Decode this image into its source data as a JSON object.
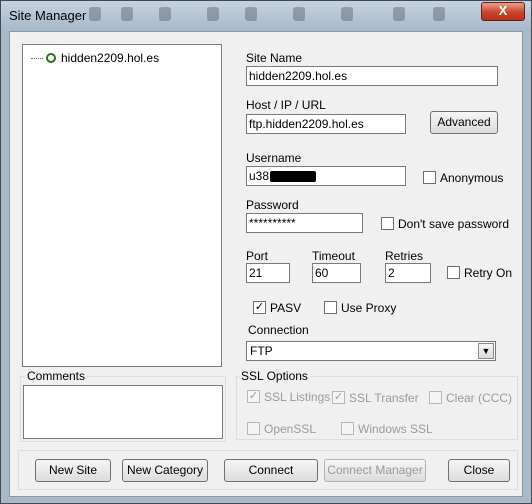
{
  "window": {
    "title": "Site Manager",
    "close_glyph": "X"
  },
  "tree": {
    "items": [
      {
        "label": "hidden2209.hol.es"
      }
    ]
  },
  "form": {
    "site_name_label": "Site Name",
    "site_name_value": "hidden2209.hol.es",
    "host_label": "Host / IP / URL",
    "host_value": "ftp.hidden2209.hol.es",
    "advanced_label": "Advanced",
    "username_label": "Username",
    "username_value": "u38",
    "anonymous_label": "Anonymous",
    "password_label": "Password",
    "password_value": "**********",
    "dont_save_label": "Don't save password",
    "port_label": "Port",
    "port_value": "21",
    "timeout_label": "Timeout",
    "timeout_value": "60",
    "retries_label": "Retries",
    "retries_value": "2",
    "retry_on_label": "Retry On",
    "pasv_label": "PASV",
    "use_proxy_label": "Use Proxy",
    "connection_label": "Connection",
    "connection_value": "FTP"
  },
  "comments": {
    "title": "Comments"
  },
  "ssl": {
    "title": "SSL Options",
    "listings_label": "SSL Listings",
    "transfer_label": "SSL Transfer",
    "clear_label": "Clear (CCC)",
    "openssl_label": "OpenSSL",
    "windows_ssl_label": "Windows SSL"
  },
  "buttons": {
    "new_site": "New Site",
    "new_category": "New Category",
    "connect": "Connect",
    "connect_manager": "Connect Manager",
    "close": "Close"
  },
  "checkmark": "✓",
  "dropdown_glyph": "▼",
  "colors": {
    "close_button": "#c8452c",
    "title_bar": "#b4c4d6"
  }
}
